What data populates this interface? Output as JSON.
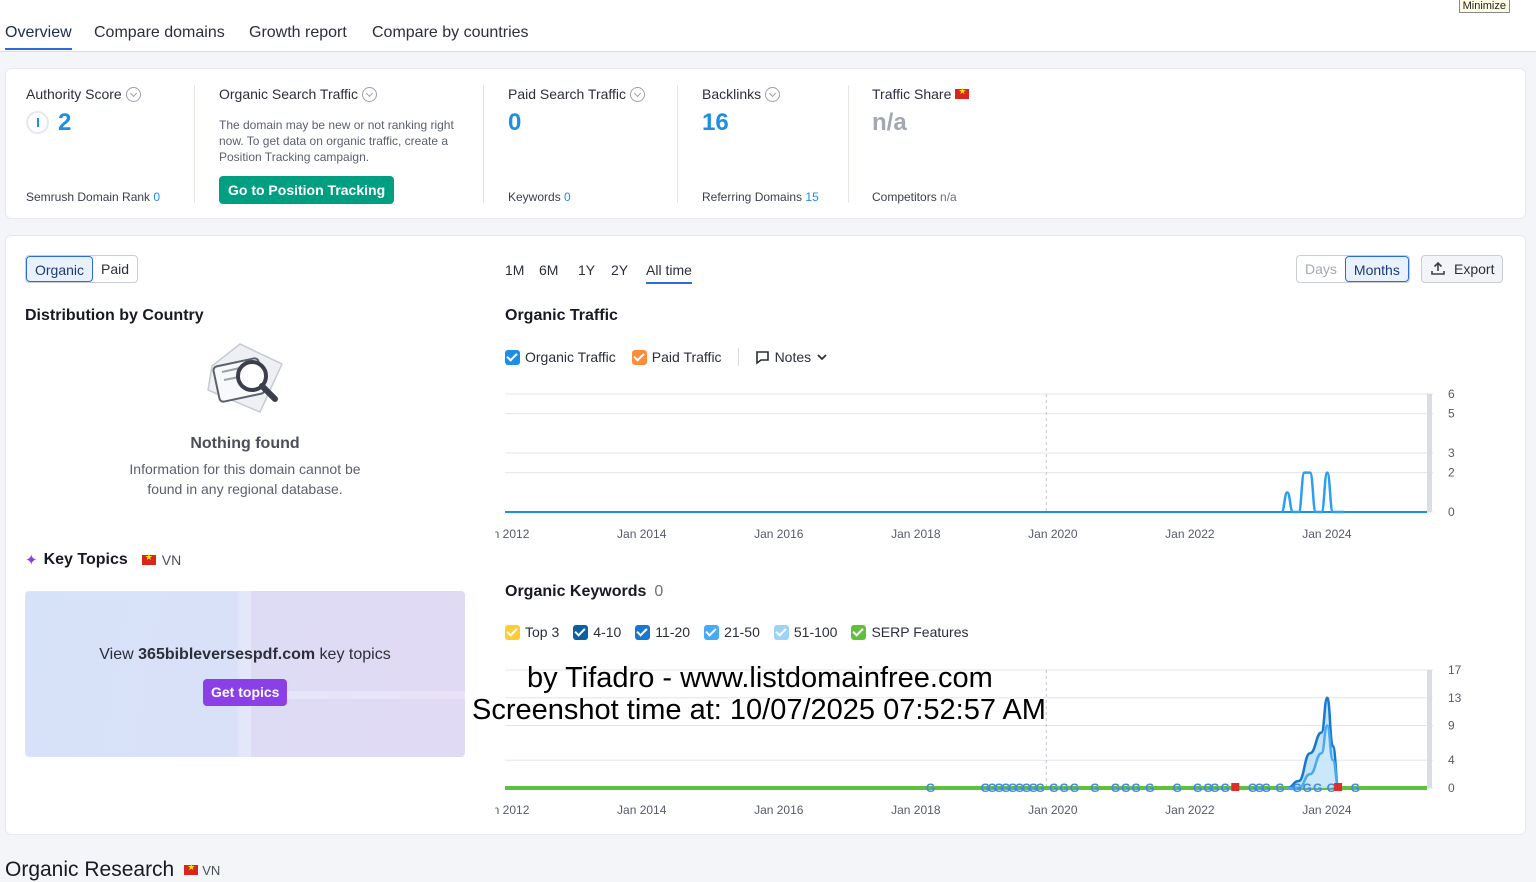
{
  "window": {
    "minimize_label": "Minimize"
  },
  "tabs": [
    "Overview",
    "Compare domains",
    "Growth report",
    "Compare by countries"
  ],
  "metrics": {
    "authority": {
      "label": "Authority Score",
      "value": "2",
      "sub_label": "Semrush Domain Rank",
      "sub_value": "0"
    },
    "organic": {
      "label": "Organic Search Traffic",
      "note": "The domain may be new or not ranking right now. To get data on organic traffic, create a Position Tracking campaign.",
      "button": "Go to Position Tracking"
    },
    "paid": {
      "label": "Paid Search Traffic",
      "value": "0",
      "sub_label": "Keywords",
      "sub_value": "0"
    },
    "backlinks": {
      "label": "Backlinks",
      "value": "16",
      "sub_label": "Referring Domains",
      "sub_value": "15"
    },
    "share": {
      "label": "Traffic Share",
      "value": "n/a",
      "sub_label": "Competitors",
      "sub_value": "n/a"
    }
  },
  "controls": {
    "organic": "Organic",
    "paid": "Paid",
    "ranges": [
      "1M",
      "6M",
      "1Y",
      "2Y",
      "All time"
    ],
    "days": "Days",
    "months": "Months",
    "export": "Export"
  },
  "distribution": {
    "title": "Distribution by Country",
    "empty_title": "Nothing found",
    "empty_text_1": "Information for this domain cannot be",
    "empty_text_2": "found in any regional database."
  },
  "key_topics": {
    "title": "Key Topics",
    "country": "VN",
    "view_prefix": "View ",
    "domain": "365bibleversespdf.com",
    "view_suffix": " key topics",
    "button": "Get topics"
  },
  "traffic_chart": {
    "title": "Organic Traffic",
    "legend": {
      "organic": "Organic Traffic",
      "paid": "Paid Traffic",
      "notes": "Notes"
    }
  },
  "keywords_chart": {
    "title": "Organic Keywords",
    "count": "0",
    "legend": {
      "top3": "Top 3",
      "r4_10": "4-10",
      "r11_20": "11-20",
      "r21_50": "21-50",
      "r51_100": "51-100",
      "serp": "SERP Features"
    }
  },
  "section_title": "Organic Research",
  "section_country": "VN",
  "watermark": {
    "line1": "by Tifadro - www.listdomainfree.com",
    "line2": "Screenshot time at: 10/07/2025 07:52:57 AM"
  },
  "colors": {
    "accent": "#1d8ee6",
    "green": "#009f81",
    "purple": "#8b3fe6",
    "organic": "#1d8ee6",
    "paid": "#ff8c3a"
  },
  "chart_data": [
    {
      "type": "line",
      "title": "Organic Traffic",
      "x_ticks": [
        "Jan 2012",
        "Jan 2014",
        "Jan 2016",
        "Jan 2018",
        "Jan 2020",
        "Jan 2022",
        "Jan 2024"
      ],
      "y_ticks": [
        0,
        2,
        3,
        5,
        6
      ],
      "ylim": [
        0,
        6
      ],
      "series": [
        {
          "name": "Organic Traffic",
          "x": [
            "2023-05",
            "2023-06",
            "2023-07",
            "2023-08",
            "2023-09",
            "2023-10",
            "2023-11",
            "2023-12",
            "2024-01",
            "2024-02",
            "2024-03",
            "2024-04"
          ],
          "values": [
            0,
            1,
            0,
            0,
            2,
            2,
            0,
            0,
            2,
            0,
            0,
            0
          ]
        }
      ]
    },
    {
      "type": "area",
      "title": "Organic Keywords",
      "x_ticks": [
        "Jan 2012",
        "Jan 2014",
        "Jan 2016",
        "Jan 2018",
        "Jan 2020",
        "Jan 2022",
        "Jan 2024"
      ],
      "y_ticks": [
        0,
        4,
        9,
        13,
        17
      ],
      "ylim": [
        0,
        17
      ],
      "series": [
        {
          "name": "4-10",
          "x": [
            "2023-06",
            "2023-08",
            "2023-10",
            "2023-12",
            "2024-01",
            "2024-02",
            "2024-03"
          ],
          "values": [
            0,
            1,
            5,
            8,
            13,
            6,
            0
          ]
        },
        {
          "name": "51-100",
          "x": [
            "2023-06",
            "2023-08",
            "2023-10",
            "2023-12",
            "2024-01",
            "2024-02",
            "2024-03"
          ],
          "values": [
            0,
            0,
            2,
            5,
            9,
            4,
            0
          ]
        }
      ]
    }
  ]
}
